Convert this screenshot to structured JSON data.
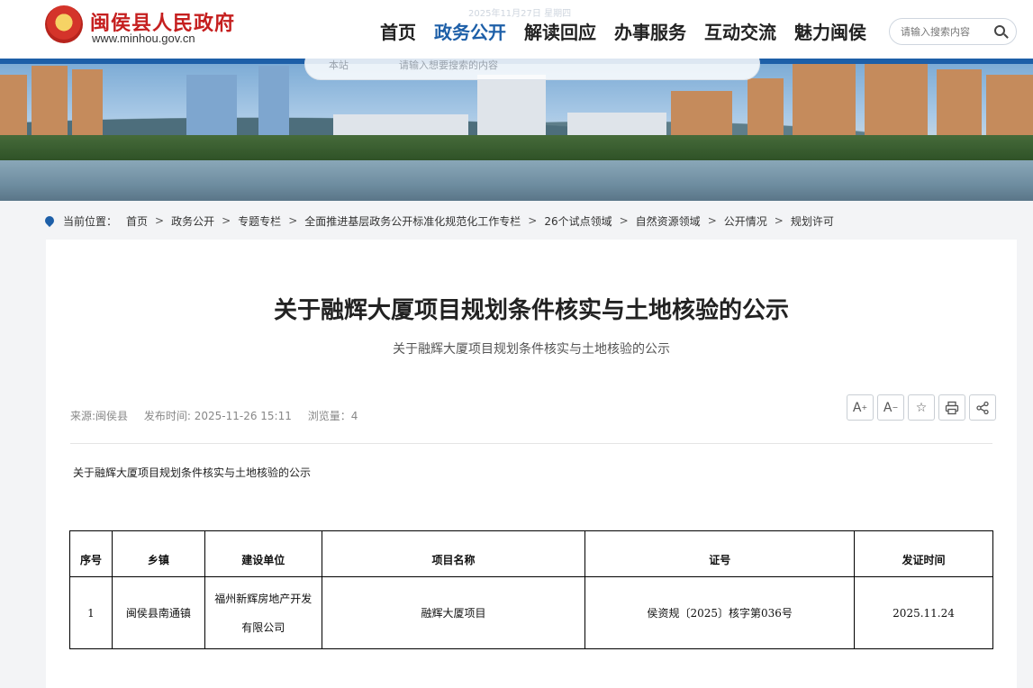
{
  "header": {
    "site_title": "闽侯县人民政府",
    "site_url": "www.minhou.gov.cn",
    "date_faint": "2025年11月27日 星期四",
    "nav": [
      {
        "label": "首页"
      },
      {
        "label": "政务公开"
      },
      {
        "label": "解读回应"
      },
      {
        "label": "办事服务"
      },
      {
        "label": "互动交流"
      },
      {
        "label": "魅力闽侯"
      }
    ],
    "active_nav": "政务公开",
    "search_placeholder": "请输入搜索内容"
  },
  "banner_search": {
    "scope": "本站",
    "placeholder": "请输入想要搜索的内容"
  },
  "breadcrumb": {
    "prefix": "当前位置：",
    "items": [
      "首页",
      "政务公开",
      "专题专栏",
      "全面推进基层政务公开标准化规范化工作专栏",
      "26个试点领域",
      "自然资源领域",
      "公开情况",
      "规划许可"
    ],
    "separator": ">"
  },
  "article": {
    "title": "关于融辉大厦项目规划条件核实与土地核验的公示",
    "subtitle": "关于融辉大厦项目规划条件核实与土地核验的公示",
    "source": "来源:闽侯县",
    "published": "发布时间: 2025-11-26 15:11",
    "views": "浏览量：4",
    "intro": "关于融辉大厦项目规划条件核实与土地核验的公示",
    "tools": {
      "font_up": "A",
      "font_down": "A"
    }
  },
  "table": {
    "headers": [
      "序号",
      "乡镇",
      "建设单位",
      "项目名称",
      "证号",
      "发证时间"
    ],
    "rows": [
      {
        "no": "1",
        "town": "闽侯县南通镇",
        "builder_line1": "福州新辉房地产开发",
        "builder_line2": "有限公司",
        "project": "融辉大厦项目",
        "cert": "侯资规〔2025〕核字第036号",
        "date": "2025.11.24"
      }
    ]
  },
  "colors": {
    "brand_red": "#c51f1f",
    "nav_active": "#1d5fa8",
    "banner_stripe": "#1d5fa8"
  }
}
